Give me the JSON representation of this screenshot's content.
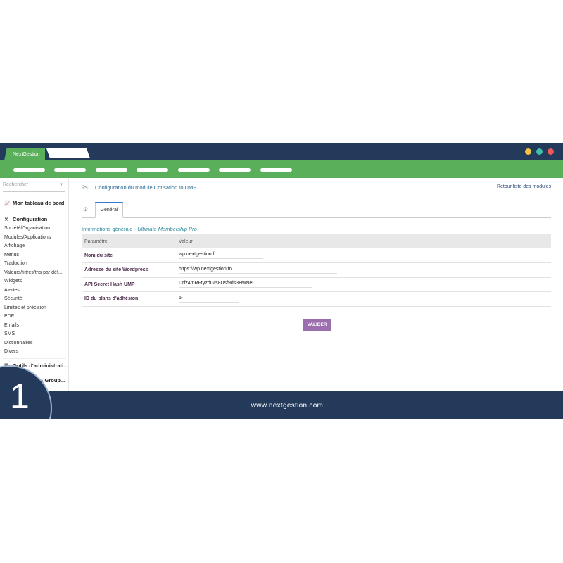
{
  "topbar": {
    "active_tab": "NextGestion"
  },
  "sidebar": {
    "search_placeholder": "Rechercher",
    "dashboard": "Mon tableau de bord",
    "configuration": "Configuration",
    "items": [
      "Société/Organisation",
      "Modules/Applications",
      "Affichage",
      "Menus",
      "Traduction",
      "Valeurs/filtres/tris par déf...",
      "Widgets",
      "Alertes",
      "Sécurité",
      "Limites et précision",
      "PDF",
      "Emails",
      "SMS",
      "Dictionnaires",
      "Divers"
    ],
    "admin_tools": "Outils d'administrati...",
    "groups": "& Group..."
  },
  "main": {
    "title": "Configuration du module Cotisation to UMP",
    "back_link": "Retour liste des modules",
    "tab_general": "Général",
    "section_title": "Informations générale - ",
    "section_title_italic": "Ultimate Membership Pro",
    "table": {
      "headers": [
        "Paramètre",
        "Valeur"
      ],
      "rows": [
        {
          "label": "Nom du site",
          "value": "wp.nextgestion.fr"
        },
        {
          "label": "Adresse du site Wordpress",
          "value": "https://wp.nextgestion.fr/"
        },
        {
          "label": "API Secret Hash UMP",
          "value": "Drfz4mRFtyzdGfs8Dsf9ds3HwNeL"
        },
        {
          "label": "ID du plans d'adhésion",
          "value": "5"
        }
      ]
    },
    "validate_button": "VALIDER"
  },
  "footer": {
    "url": "www.nextgestion.com"
  },
  "badge": {
    "number": "1"
  },
  "colors": {
    "navy": "#243a5a",
    "green": "#5aaf5a",
    "button": "#9b6fae"
  }
}
